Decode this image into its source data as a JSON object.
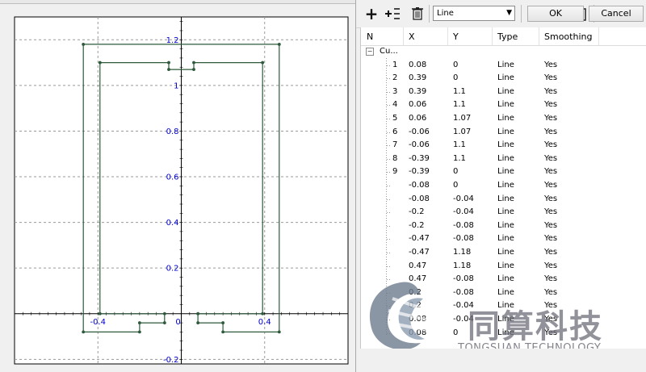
{
  "plot": {
    "x_ticks": [
      "-0.4",
      "0",
      "0.4"
    ],
    "y_ticks": [
      "1.2",
      "1",
      "0.8",
      "0.6",
      "0.4",
      "0.2",
      "-0.2"
    ],
    "axis_color": "#0000cc",
    "curve_color": "#2d5a3b",
    "chart_data": {
      "type": "line",
      "series": [
        {
          "points": [
            [
              0.08,
              0
            ],
            [
              0.39,
              0
            ],
            [
              0.39,
              1.1
            ],
            [
              0.06,
              1.1
            ],
            [
              0.06,
              1.07
            ],
            [
              -0.06,
              1.07
            ],
            [
              -0.06,
              1.1
            ],
            [
              -0.39,
              1.1
            ],
            [
              -0.39,
              0
            ],
            [
              -0.08,
              0
            ],
            [
              -0.08,
              -0.04
            ],
            [
              -0.2,
              -0.04
            ],
            [
              -0.2,
              -0.08
            ],
            [
              -0.47,
              -0.08
            ],
            [
              -0.47,
              1.18
            ],
            [
              0.47,
              1.18
            ],
            [
              0.47,
              -0.08
            ],
            [
              0.2,
              -0.08
            ],
            [
              0.2,
              -0.04
            ],
            [
              0.08,
              -0.04
            ],
            [
              0.08,
              0
            ]
          ]
        }
      ],
      "xlim": [
        -0.8,
        0.8
      ],
      "ylim": [
        -0.22,
        1.3
      ],
      "grid": true
    }
  },
  "toolbar": {
    "add_icon": "+",
    "curve_type_value": "Line",
    "curve_type_arrow": "▼"
  },
  "table": {
    "headers": [
      "N",
      "X",
      "Y",
      "Type",
      "Smoothing"
    ],
    "group_label": "Cu...",
    "rows": [
      {
        "n": "1",
        "x": "0.08",
        "y": "0",
        "type": "Line",
        "smooth": "Yes"
      },
      {
        "n": "2",
        "x": "0.39",
        "y": "0",
        "type": "Line",
        "smooth": "Yes"
      },
      {
        "n": "3",
        "x": "0.39",
        "y": "1.1",
        "type": "Line",
        "smooth": "Yes"
      },
      {
        "n": "4",
        "x": "0.06",
        "y": "1.1",
        "type": "Line",
        "smooth": "Yes"
      },
      {
        "n": "5",
        "x": "0.06",
        "y": "1.07",
        "type": "Line",
        "smooth": "Yes"
      },
      {
        "n": "6",
        "x": "-0.06",
        "y": "1.07",
        "type": "Line",
        "smooth": "Yes"
      },
      {
        "n": "7",
        "x": "-0.06",
        "y": "1.1",
        "type": "Line",
        "smooth": "Yes"
      },
      {
        "n": "8",
        "x": "-0.39",
        "y": "1.1",
        "type": "Line",
        "smooth": "Yes"
      },
      {
        "n": "9",
        "x": "-0.39",
        "y": "0",
        "type": "Line",
        "smooth": "Yes"
      },
      {
        "n": "",
        "x": "-0.08",
        "y": "0",
        "type": "Line",
        "smooth": "Yes"
      },
      {
        "n": "",
        "x": "-0.08",
        "y": "-0.04",
        "type": "Line",
        "smooth": "Yes"
      },
      {
        "n": "",
        "x": "-0.2",
        "y": "-0.04",
        "type": "Line",
        "smooth": "Yes"
      },
      {
        "n": "",
        "x": "-0.2",
        "y": "-0.08",
        "type": "Line",
        "smooth": "Yes"
      },
      {
        "n": "",
        "x": "-0.47",
        "y": "-0.08",
        "type": "Line",
        "smooth": "Yes"
      },
      {
        "n": "",
        "x": "-0.47",
        "y": "1.18",
        "type": "Line",
        "smooth": "Yes"
      },
      {
        "n": "",
        "x": "0.47",
        "y": "1.18",
        "type": "Line",
        "smooth": "Yes"
      },
      {
        "n": "",
        "x": "0.47",
        "y": "-0.08",
        "type": "Line",
        "smooth": "Yes"
      },
      {
        "n": "",
        "x": "0.2",
        "y": "-0.08",
        "type": "Line",
        "smooth": "Yes"
      },
      {
        "n": "",
        "x": "0.2",
        "y": "-0.04",
        "type": "Line",
        "smooth": "Yes"
      },
      {
        "n": "",
        "x": "0.08",
        "y": "-0.04",
        "type": "Line",
        "smooth": "Yes"
      },
      {
        "n": "",
        "x": "0.08",
        "y": "0",
        "type": "Line",
        "smooth": "Yes"
      }
    ]
  },
  "footer": {
    "ok_label": "OK",
    "cancel_label": "Cancel"
  },
  "watermark": {
    "cn": "同算科技",
    "en": "TONGSUAN TECHNOLOGY"
  }
}
